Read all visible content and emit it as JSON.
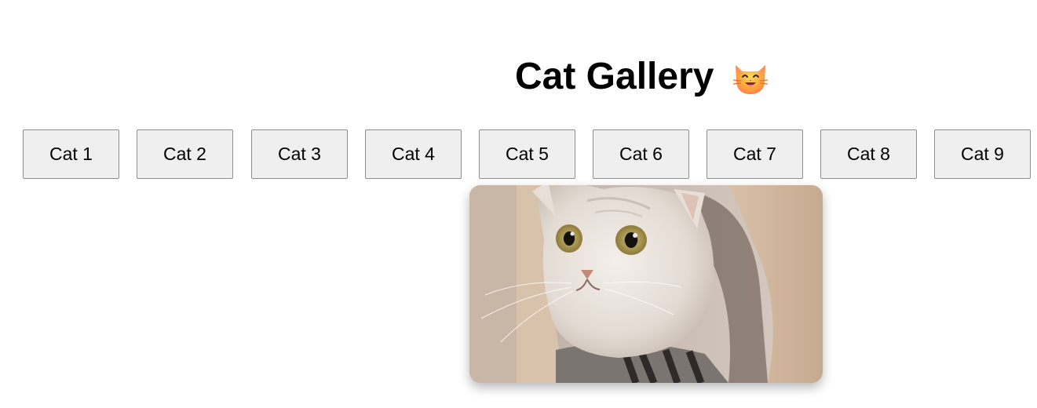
{
  "page": {
    "title": "Cat Gallery",
    "title_icon": "grinning-cat-face-icon"
  },
  "buttons": [
    {
      "label": "Cat 1"
    },
    {
      "label": "Cat 2"
    },
    {
      "label": "Cat 3"
    },
    {
      "label": "Cat 4"
    },
    {
      "label": "Cat 5"
    },
    {
      "label": "Cat 6"
    },
    {
      "label": "Cat 7"
    },
    {
      "label": "Cat 8"
    },
    {
      "label": "Cat 9"
    }
  ],
  "preview": {
    "icon": "cat-photo"
  },
  "colors": {
    "button_bg": "#efefef",
    "button_border": "#8d8d8d",
    "text": "#000000"
  }
}
